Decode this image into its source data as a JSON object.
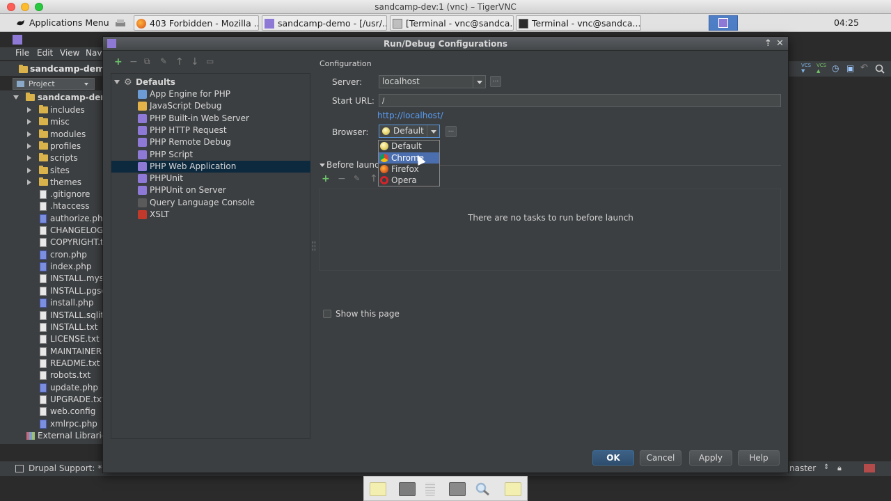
{
  "vnc": {
    "title": "sandcamp-dev:1 (vnc) – TigerVNC"
  },
  "panel": {
    "apps_menu": "Applications Menu",
    "tasks": [
      {
        "label": "403 Forbidden - Mozilla ..."
      },
      {
        "label": "sandcamp-demo - [/usr/..."
      },
      {
        "label": "[Terminal - vnc@sandca..."
      },
      {
        "label": "Terminal - vnc@sandca..."
      }
    ],
    "clock": "04:25"
  },
  "ide": {
    "menu": {
      "file": "File",
      "edit": "Edit",
      "view": "View",
      "navigate": "Navi"
    },
    "nav_title": "sandcamp-demo",
    "project_label": "Project",
    "tree_root": "sandcamp-demo",
    "folders": [
      "includes",
      "misc",
      "modules",
      "profiles",
      "scripts",
      "sites",
      "themes"
    ],
    "files": [
      ".gitignore",
      ".htaccess",
      "authorize.php",
      "CHANGELOG.t",
      "COPYRIGHT.tx",
      "cron.php",
      "index.php",
      "INSTALL.mysq",
      "INSTALL.pgsq",
      "install.php",
      "INSTALL.sqlite",
      "INSTALL.txt",
      "LICENSE.txt",
      "MAINTAINERS",
      "README.txt",
      "robots.txt",
      "update.php",
      "UPGRADE.txt",
      "web.config",
      "xmlrpc.php"
    ],
    "external_libraries": "External Librarie",
    "status_left": "Drupal Support: *.i",
    "status_branch": "naster"
  },
  "dialog": {
    "title": "Run/Debug Configurations",
    "tree": {
      "defaults_label": "Defaults",
      "items": [
        "App Engine for PHP",
        "JavaScript Debug",
        "PHP Built-in Web Server",
        "PHP HTTP Request",
        "PHP Remote Debug",
        "PHP Script",
        "PHP Web Application",
        "PHPUnit",
        "PHPUnit on Server",
        "Query Language Console",
        "XSLT"
      ]
    },
    "config": {
      "section": "Configuration",
      "server_label": "Server:",
      "server_value": "localhost",
      "start_url_label": "Start URL:",
      "start_url_value": "/",
      "url_link": "http://localhost/",
      "browser_label": "Browser:",
      "browser_value": "Default",
      "browser_options": [
        "Default",
        "Chrome",
        "Firefox",
        "Opera"
      ],
      "before_launch": "Before launch",
      "no_tasks": "There are no tasks to run before launch",
      "show_page": "Show this page"
    },
    "buttons": {
      "ok": "OK",
      "cancel": "Cancel",
      "apply": "Apply",
      "help": "Help"
    }
  },
  "colors": {
    "accent": "#4b6eaf",
    "link": "#589df6",
    "selected_row": "#0d293e"
  }
}
